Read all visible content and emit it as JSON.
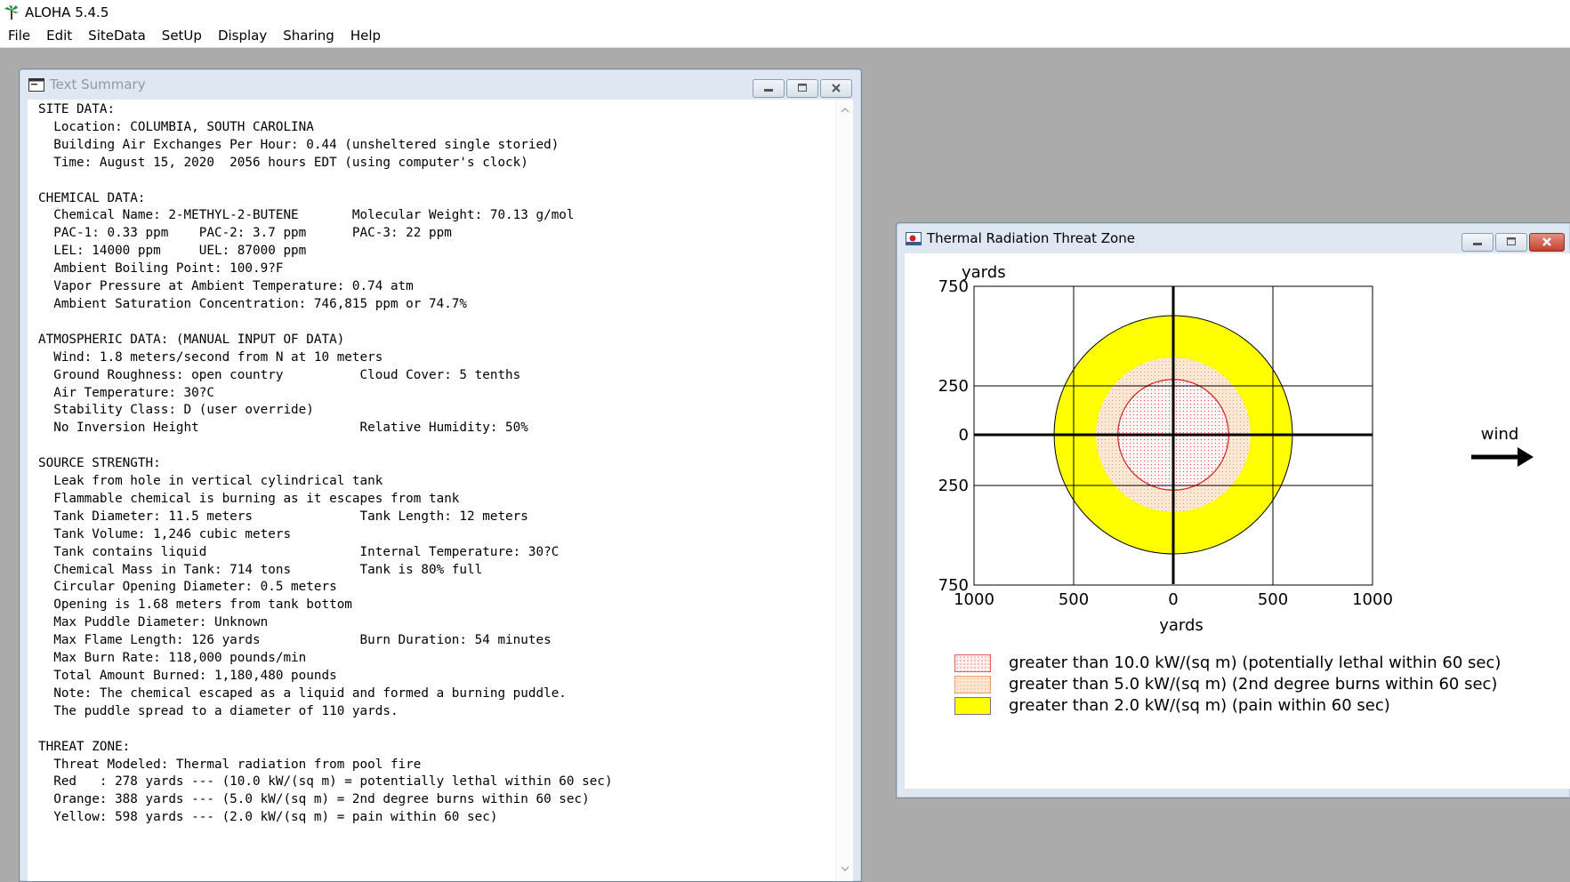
{
  "app": {
    "title": "ALOHA 5.4.5",
    "menu": [
      "File",
      "Edit",
      "SiteData",
      "SetUp",
      "Display",
      "Sharing",
      "Help"
    ]
  },
  "summary_window": {
    "title": "Text Summary",
    "lines": [
      "SITE DATA:",
      "  Location: COLUMBIA, SOUTH CAROLINA",
      "  Building Air Exchanges Per Hour: 0.44 (unsheltered single storied)",
      "  Time: August 15, 2020  2056 hours EDT (using computer's clock)",
      "",
      "CHEMICAL DATA:",
      "  Chemical Name: 2-METHYL-2-BUTENE       Molecular Weight: 70.13 g/mol",
      "  PAC-1: 0.33 ppm    PAC-2: 3.7 ppm      PAC-3: 22 ppm",
      "  LEL: 14000 ppm     UEL: 87000 ppm",
      "  Ambient Boiling Point: 100.9?F",
      "  Vapor Pressure at Ambient Temperature: 0.74 atm",
      "  Ambient Saturation Concentration: 746,815 ppm or 74.7%",
      "",
      "ATMOSPHERIC DATA: (MANUAL INPUT OF DATA)",
      "  Wind: 1.8 meters/second from N at 10 meters",
      "  Ground Roughness: open country          Cloud Cover: 5 tenths",
      "  Air Temperature: 30?C",
      "  Stability Class: D (user override)",
      "  No Inversion Height                     Relative Humidity: 50%",
      "",
      "SOURCE STRENGTH:",
      "  Leak from hole in vertical cylindrical tank",
      "  Flammable chemical is burning as it escapes from tank",
      "  Tank Diameter: 11.5 meters              Tank Length: 12 meters",
      "  Tank Volume: 1,246 cubic meters",
      "  Tank contains liquid                    Internal Temperature: 30?C",
      "  Chemical Mass in Tank: 714 tons         Tank is 80% full",
      "  Circular Opening Diameter: 0.5 meters",
      "  Opening is 1.68 meters from tank bottom",
      "  Max Puddle Diameter: Unknown",
      "  Max Flame Length: 126 yards             Burn Duration: 54 minutes",
      "  Max Burn Rate: 118,000 pounds/min",
      "  Total Amount Burned: 1,180,480 pounds",
      "  Note: The chemical escaped as a liquid and formed a burning puddle.",
      "  The puddle spread to a diameter of 110 yards.",
      "",
      "THREAT ZONE:",
      "  Threat Modeled: Thermal radiation from pool fire",
      "  Red   : 278 yards --- (10.0 kW/(sq m) = potentially lethal within 60 sec)",
      "  Orange: 388 yards --- (5.0 kW/(sq m) = 2nd degree burns within 60 sec)",
      "  Yellow: 598 yards --- (2.0 kW/(sq m) = pain within 60 sec)"
    ]
  },
  "threat_window": {
    "title": "Thermal Radiation Threat Zone",
    "ylabel": "yards",
    "xlabel": "yards",
    "wind_label": "wind",
    "y_ticks": [
      "750",
      "250",
      "0",
      "250",
      "750"
    ],
    "x_ticks": [
      "1000",
      "500",
      "0",
      "500",
      "1000"
    ],
    "zones": [
      {
        "label": "greater than 10.0 kW/(sq m) (potentially lethal within 60 sec)",
        "radius_yards": 278,
        "color": "#ff3333"
      },
      {
        "label": "greater than 5.0 kW/(sq m) (2nd degree burns within 60 sec)",
        "radius_yards": 388,
        "color": "#ffa040"
      },
      {
        "label": "greater than 2.0 kW/(sq m) (pain within 60 sec)",
        "radius_yards": 598,
        "color": "#ffff00"
      }
    ]
  }
}
